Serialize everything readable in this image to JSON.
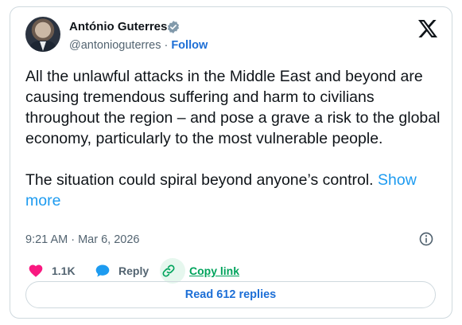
{
  "author": {
    "name": "António Guterres",
    "handle": "@antonioguterres",
    "separator": "·",
    "follow_label": "Follow"
  },
  "tweet": {
    "paragraph_1": "All the unlawful attacks in the Middle East and beyond are causing tremendous suffering and harm to civilians throughout the region – and pose a grave a risk to the global economy, particularly to the most vulnerable people.",
    "paragraph_2": "The situation could spiral beyond anyone’s control.",
    "show_more_label": "Show more",
    "timestamp": "9:21 AM · Mar 6, 2026"
  },
  "actions": {
    "likes": "1.1K",
    "reply_label": "Reply",
    "copy_link_label": "Copy link"
  },
  "replies_button": "Read 612 replies",
  "colors": {
    "like": "#f91880",
    "reply": "#1d9bf0",
    "copy_link": "#00a35c",
    "link_blue": "#1d6fd6",
    "verified": "#829aab"
  },
  "icons": [
    "verified-badge-icon",
    "x-logo-icon",
    "info-icon",
    "heart-icon",
    "reply-bubble-icon",
    "link-icon"
  ]
}
